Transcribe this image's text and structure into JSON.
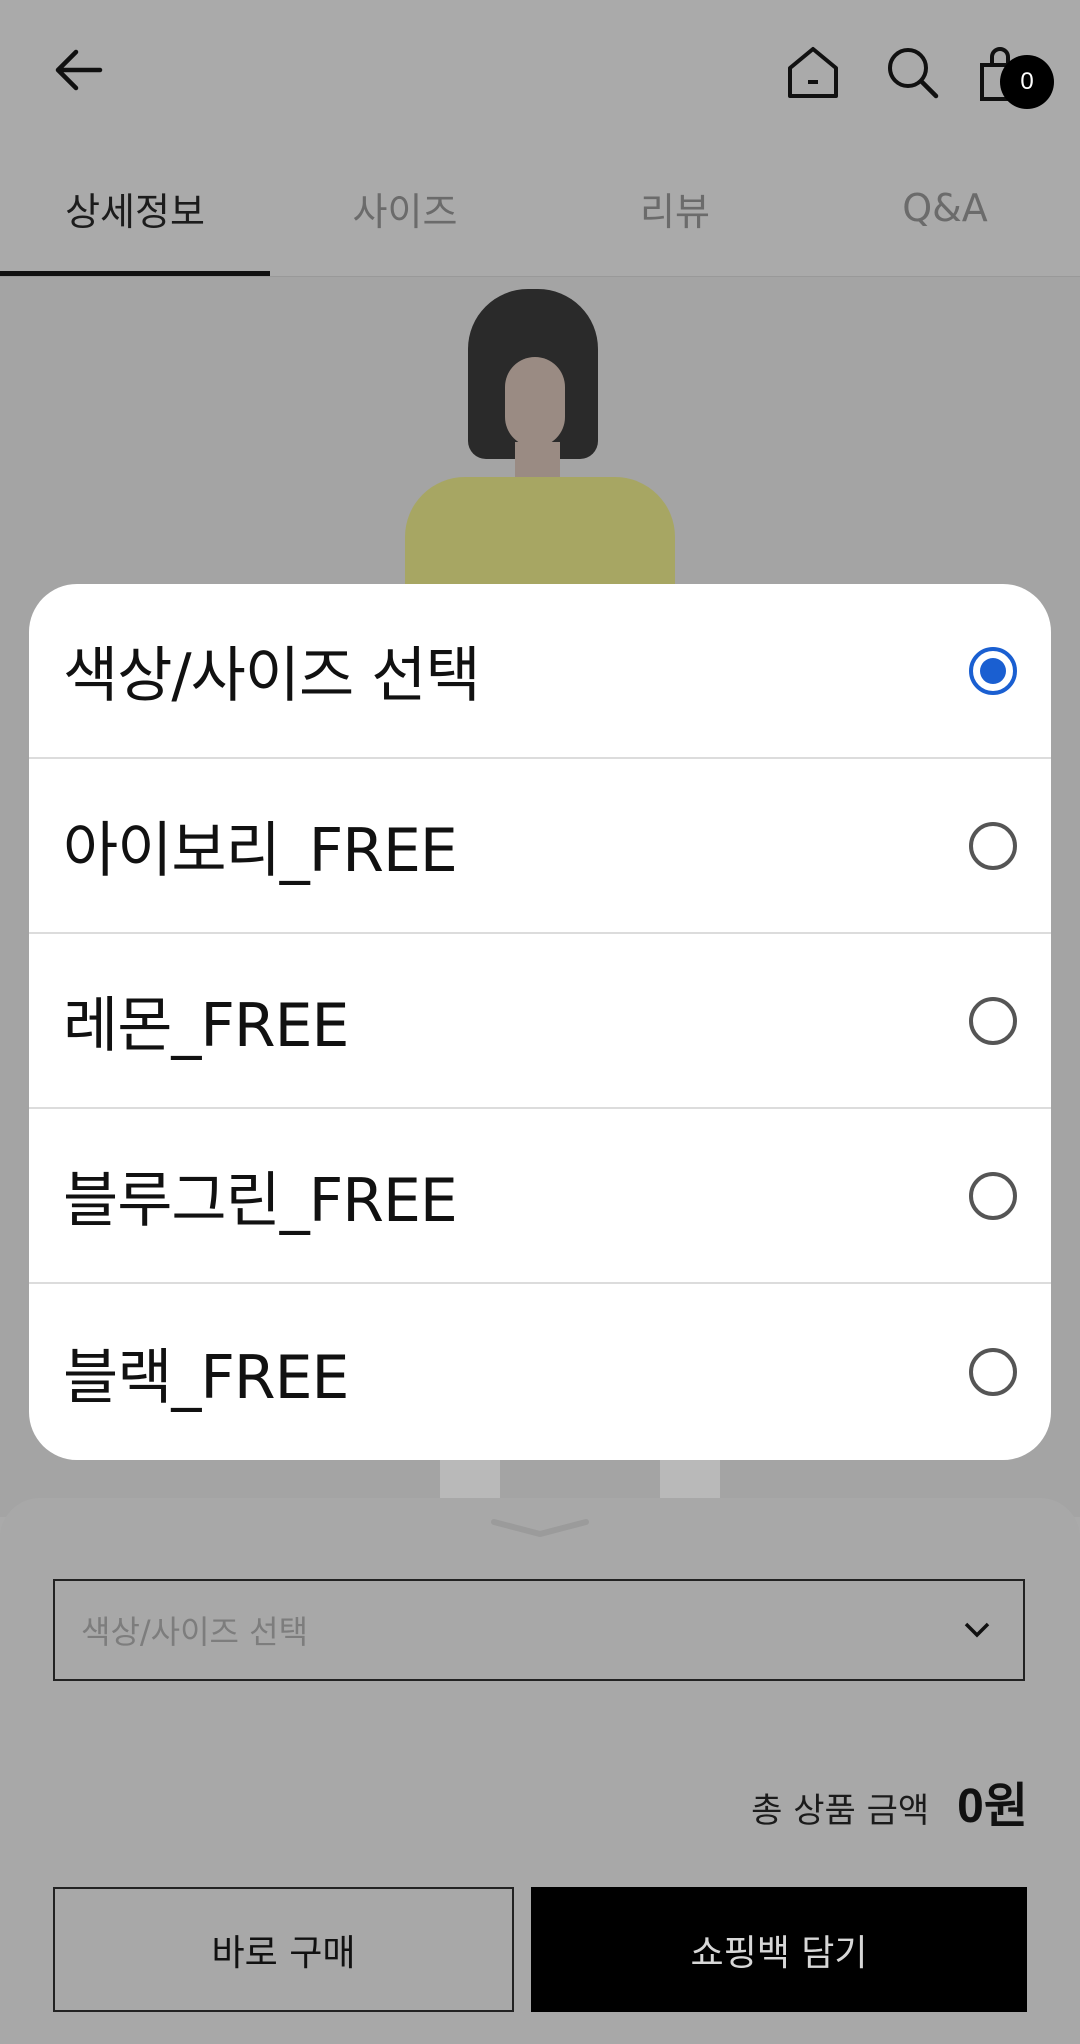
{
  "header": {
    "back_icon": "arrow-left-icon",
    "home_icon": "home-icon",
    "search_icon": "search-icon",
    "bag_icon": "shopping-bag-icon",
    "bag_count": "0"
  },
  "tabs": [
    {
      "label": "상세정보",
      "active": true
    },
    {
      "label": "사이즈",
      "active": false
    },
    {
      "label": "리뷰",
      "active": false
    },
    {
      "label": "Q&A",
      "active": false
    }
  ],
  "sheet": {
    "select_placeholder": "색상/사이즈 선택",
    "total_label": "총 상품 금액",
    "total_value": "0원",
    "buy_now_label": "바로 구매",
    "add_to_bag_label": "쇼핑백 담기"
  },
  "dialog": {
    "options": [
      {
        "label": "색상/사이즈 선택",
        "selected": true
      },
      {
        "label": "아이보리_FREE",
        "selected": false
      },
      {
        "label": "레몬_FREE",
        "selected": false
      },
      {
        "label": "블루그린_FREE",
        "selected": false
      },
      {
        "label": "블랙_FREE",
        "selected": false
      }
    ]
  },
  "colors": {
    "accent": "#1a5fd1",
    "scrim": "#aaaaaa",
    "primary_button": "#000000"
  }
}
